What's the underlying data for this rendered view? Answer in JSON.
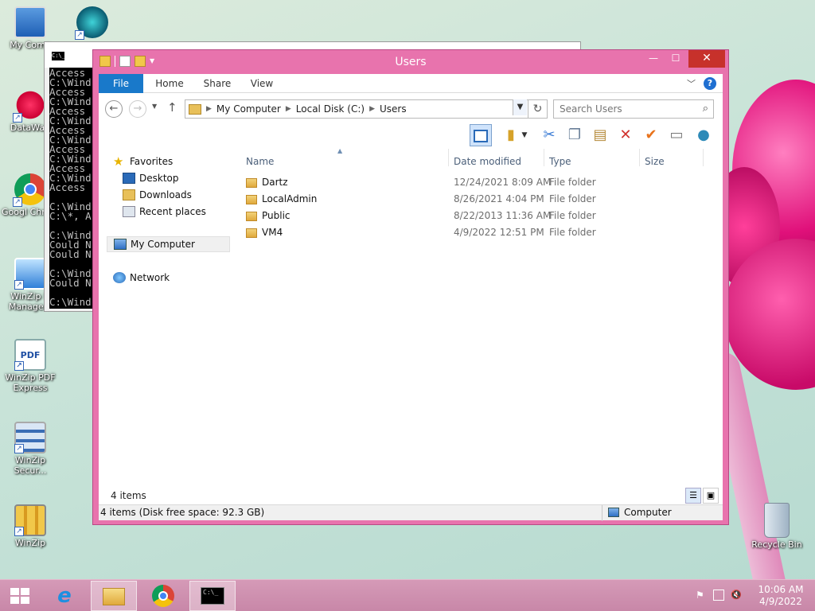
{
  "desktop": {
    "icons": [
      {
        "label": "My Comp"
      },
      {
        "label": "DataWag"
      },
      {
        "label": "Googl Chrom"
      },
      {
        "label": "WinZip Ir Manage..."
      },
      {
        "label": "WinZip PDF Express"
      },
      {
        "label": "WinZip Secur..."
      },
      {
        "label": "WinZip"
      },
      {
        "label": "Recycle Bin"
      }
    ]
  },
  "console": {
    "icon_text": "C:\\_",
    "lines": "Access\nC:\\Wind\nAccess\nC:\\Wind\nAccess\nC:\\Wind\nAccess\nC:\\Wind\nAccess\nC:\\Wind\nAccess\nC:\\Wind\nAccess\n\nC:\\Wind\nC:\\*, A\n\nC:\\Wind\nCould N\nCould N\n\nC:\\Wind\nCould N\n\nC:\\Wind"
  },
  "explorer": {
    "title": "Users",
    "controls": {
      "minimize": "—",
      "maximize": "☐",
      "close": "✕"
    },
    "ribbon_tabs": {
      "file": "File",
      "home": "Home",
      "share": "Share",
      "view": "View"
    },
    "address": {
      "crumbs": [
        "My Computer",
        "Local Disk (C:)",
        "Users"
      ]
    },
    "search": {
      "placeholder": "Search Users"
    },
    "nav": {
      "favorites": "Favorites",
      "desktop": "Desktop",
      "downloads": "Downloads",
      "recent": "Recent places",
      "computer": "My Computer",
      "network": "Network"
    },
    "columns": {
      "name": "Name",
      "date": "Date modified",
      "type": "Type",
      "size": "Size"
    },
    "files": [
      {
        "name": "Dartz",
        "date": "12/24/2021 8:09 AM",
        "type": "File folder"
      },
      {
        "name": "LocalAdmin",
        "date": "8/26/2021 4:04 PM",
        "type": "File folder"
      },
      {
        "name": "Public",
        "date": "8/22/2013 11:36 AM",
        "type": "File folder"
      },
      {
        "name": "VM4",
        "date": "4/9/2022 12:51 PM",
        "type": "File folder"
      }
    ],
    "status": {
      "count": "4 items",
      "detail": "4 items (Disk free space: 92.3 GB)",
      "location": "Computer"
    }
  },
  "taskbar": {
    "time": "10:06 AM",
    "date": "4/9/2022",
    "console_label": "C:\\_"
  },
  "colors": {
    "window_frame": "#e873ad",
    "close_red": "#c7312b",
    "file_tab": "#1979ca",
    "taskbar": "#c887a8"
  }
}
